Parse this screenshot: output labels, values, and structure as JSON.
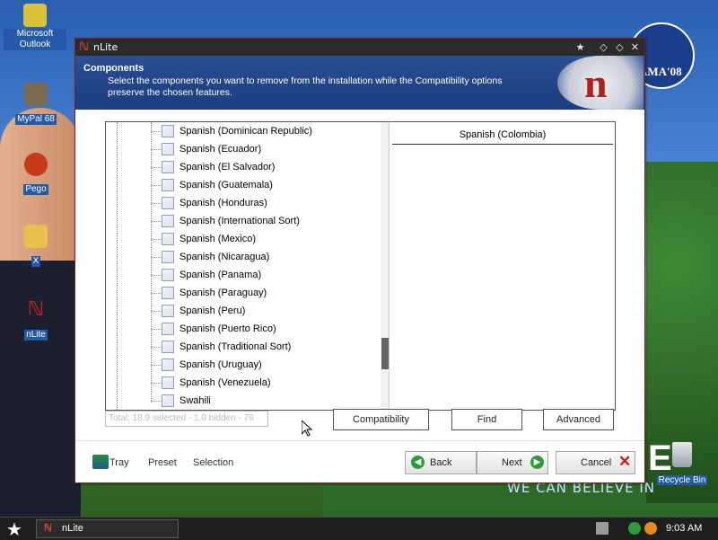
{
  "desktop": {
    "icons": [
      {
        "label": "Microsoft Outlook"
      },
      {
        "label": "MyPal 68"
      },
      {
        "label": "Pego"
      },
      {
        "label": "X"
      },
      {
        "label": "nLite"
      }
    ],
    "recycle_bin": "Recycle Bin",
    "wallpaper_logo": "AMA'08",
    "wallpaper_slogan": "WE CAN BELIEVE IN",
    "wallpaper_letter": "E"
  },
  "window": {
    "title": "nLite",
    "header": {
      "title": "Components",
      "description": "Select the components you want to remove from the installation while the Compatibility options preserve the chosen features."
    },
    "tree_items": [
      "Spanish (Dominican Republic)",
      "Spanish (Ecuador)",
      "Spanish (El Salvador)",
      "Spanish (Guatemala)",
      "Spanish (Honduras)",
      "Spanish (International Sort)",
      "Spanish (Mexico)",
      "Spanish (Nicaragua)",
      "Spanish (Panama)",
      "Spanish (Paraguay)",
      "Spanish (Peru)",
      "Spanish (Puerto Rico)",
      "Spanish (Traditional Sort)",
      "Spanish (Uruguay)",
      "Spanish (Venezuela)",
      "Swahili"
    ],
    "info_title": "Spanish (Colombia)",
    "status_text": "Total: 18.9 selected - 1.0 hidden - 76",
    "buttons": {
      "compatibility": "Compatibility",
      "find": "Find",
      "advanced": "Advanced",
      "tray": "Tray",
      "preset": "Preset",
      "selection": "Selection",
      "back": "Back",
      "next": "Next",
      "cancel": "Cancel"
    }
  },
  "taskbar": {
    "task": "nLite",
    "clock": "9:03 AM"
  }
}
